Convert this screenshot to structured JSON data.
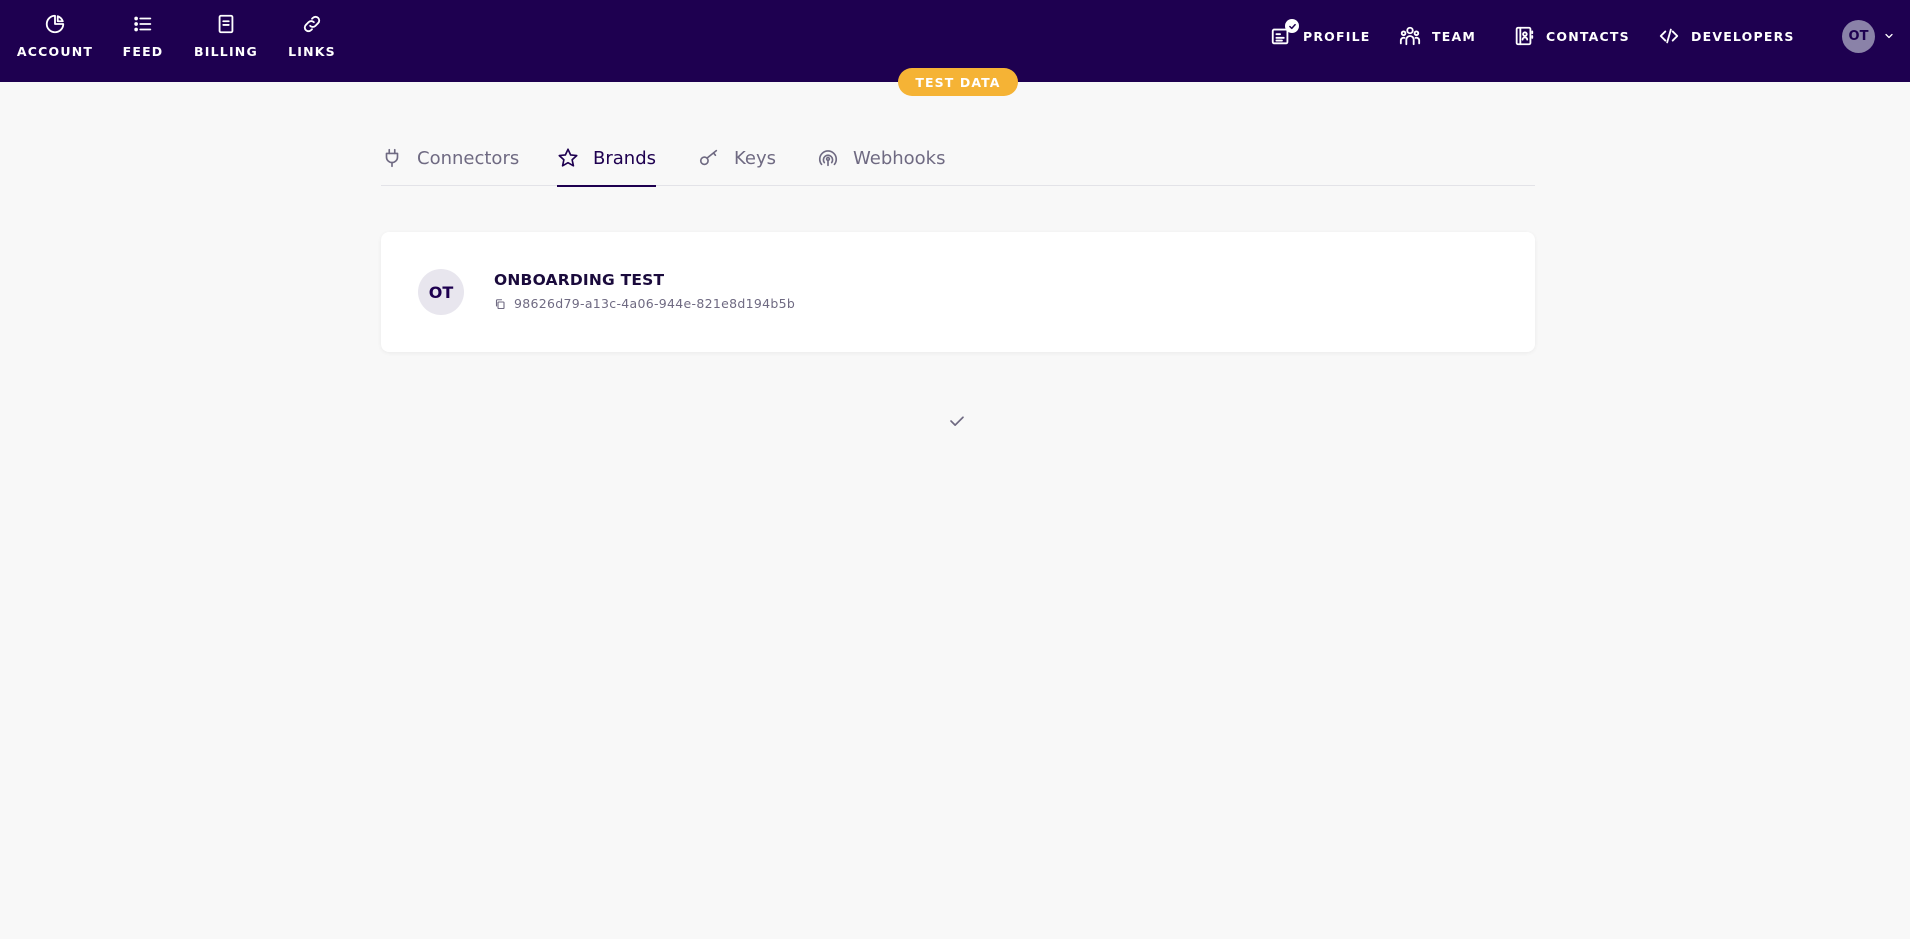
{
  "topnav": {
    "left": [
      {
        "label": "ACCOUNT",
        "icon": "pie-chart-icon"
      },
      {
        "label": "FEED",
        "icon": "list-icon"
      },
      {
        "label": "BILLING",
        "icon": "document-icon"
      },
      {
        "label": "LINKS",
        "icon": "link-icon"
      }
    ],
    "right": [
      {
        "label": "PROFILE",
        "icon": "profile-card-icon"
      },
      {
        "label": "TEAM",
        "icon": "team-icon"
      },
      {
        "label": "CONTACTS",
        "icon": "contacts-book-icon"
      },
      {
        "label": "DEVELOPERS",
        "icon": "code-icon"
      }
    ],
    "user_initials": "OT"
  },
  "test_badge": "TEST DATA",
  "tabs": [
    {
      "label": "Connectors",
      "icon": "plug-icon",
      "active": false
    },
    {
      "label": "Brands",
      "icon": "star-icon",
      "active": true
    },
    {
      "label": "Keys",
      "icon": "key-icon",
      "active": false
    },
    {
      "label": "Webhooks",
      "icon": "webhook-icon",
      "active": false
    }
  ],
  "brand": {
    "initials": "OT",
    "name": "ONBOARDING TEST",
    "id": "98626d79-a13c-4a06-944e-821e8d194b5b"
  },
  "colors": {
    "topbar_bg": "#1e0050",
    "accent_badge": "#f5b335",
    "page_bg": "#f8f8f8",
    "active_tab": "#1e0050",
    "inactive_tab": "#6f6a82"
  }
}
